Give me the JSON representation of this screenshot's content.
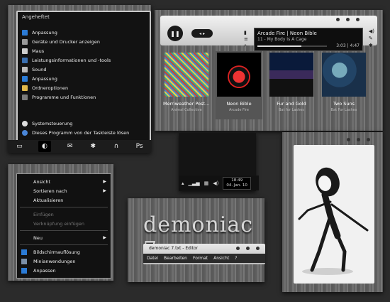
{
  "start_menu": {
    "title": "Angeheftet",
    "items": [
      {
        "label": "Anpassung",
        "icon": "display-icon",
        "color": "#2b7bd6"
      },
      {
        "label": "Geräte und Drucker anzeigen",
        "icon": "printer-icon",
        "color": "#9a9a9a"
      },
      {
        "label": "Maus",
        "icon": "mouse-icon",
        "color": "#cccccc"
      },
      {
        "label": "Leistungsinformationen und -tools",
        "icon": "performance-icon",
        "color": "#3a6fb0"
      },
      {
        "label": "Sound",
        "icon": "speaker-icon",
        "color": "#bbbbbb"
      },
      {
        "label": "Anpassung",
        "icon": "display-icon",
        "color": "#2b7bd6"
      },
      {
        "label": "Ordneroptionen",
        "icon": "folder-icon",
        "color": "#e1b84a"
      },
      {
        "label": "Programme und Funktionen",
        "icon": "programs-icon",
        "color": "#7a7a7a"
      }
    ],
    "bottom_items": [
      {
        "label": "Systemsteuerung",
        "icon": "gear-icon",
        "color": "#dddddd"
      },
      {
        "label": "Dieses Programm von der Taskleiste lösen",
        "icon": "unpin-icon",
        "color": "#4a86d8"
      }
    ],
    "taskbar": [
      "computer-icon",
      "media-icon",
      "mail-icon",
      "settings-icon",
      "headphones-icon",
      "photoshop-icon"
    ],
    "taskbar_glyphs": [
      "▭",
      "◐",
      "✉",
      "✱",
      "∩",
      "Ps"
    ]
  },
  "player": {
    "track_line1": "Arcade Fire | Neon Bible",
    "track_line2": "11 - My Body Is A Cage",
    "time": "3:03 | 4:47",
    "albums": [
      {
        "title": "Merriweather Post Pa...",
        "artist": "Animal Collective"
      },
      {
        "title": "Neon Bible",
        "artist": "Arcade Fire"
      },
      {
        "title": "Fur and Gold",
        "artist": "Bat for Lashes"
      },
      {
        "title": "Two Suns",
        "artist": "Bat For Lashes"
      }
    ]
  },
  "tray": {
    "time": "18:49",
    "date": "04. Jan. 10"
  },
  "context_menu": {
    "items": [
      {
        "label": "Ansicht",
        "submenu": true,
        "disabled": false
      },
      {
        "label": "Sortieren nach",
        "submenu": true,
        "disabled": false
      },
      {
        "label": "Aktualisieren",
        "submenu": false,
        "disabled": false
      },
      {
        "label": "Einfügen",
        "submenu": false,
        "disabled": true
      },
      {
        "label": "Verknüpfung einfügen",
        "submenu": false,
        "disabled": true
      },
      {
        "label": "Neu",
        "submenu": true,
        "disabled": false
      },
      {
        "label": "Bildschirmauflösung",
        "submenu": false,
        "disabled": false
      },
      {
        "label": "Minianwendungen",
        "submenu": false,
        "disabled": false
      },
      {
        "label": "Anpassen",
        "submenu": false,
        "disabled": false
      }
    ]
  },
  "editor": {
    "brand": "demoniac 7",
    "window_title": "demoniac 7.txt - Editor",
    "menu": [
      "Datei",
      "Bearbeiten",
      "Format",
      "Ansicht",
      "?"
    ]
  }
}
